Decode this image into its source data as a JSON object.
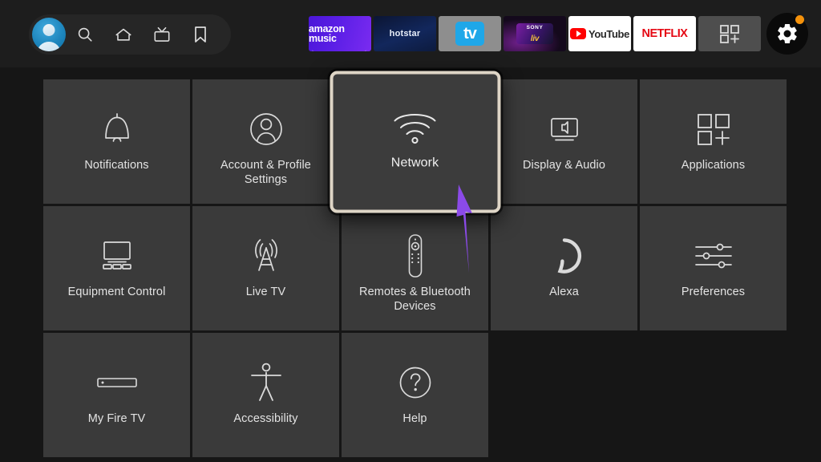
{
  "topbar": {
    "profile": {
      "icon": "profile-avatar-icon",
      "label": "Profile"
    },
    "nav_icons": [
      {
        "name": "search-icon",
        "label": "Search"
      },
      {
        "name": "home-icon",
        "label": "Home"
      },
      {
        "name": "live-tv-icon",
        "label": "Live TV"
      },
      {
        "name": "bookmark-icon",
        "label": "Watchlist"
      }
    ],
    "apps": [
      {
        "id": "amazon-music",
        "label": "amazon music",
        "bg": "#5b1fe6"
      },
      {
        "id": "hotstar",
        "label": "hotstar",
        "bg": "#12275c"
      },
      {
        "id": "apple-tv",
        "label": "tv",
        "bg": "#8e8e8e",
        "accent": "#1fa7e8"
      },
      {
        "id": "sony-liv",
        "label": "SONY",
        "sublabel": "liv",
        "bg": "#0a0a12",
        "accent": "#f5c33b"
      },
      {
        "id": "youtube",
        "label": "YouTube",
        "bg": "#ffffff",
        "accent": "#ff0000"
      },
      {
        "id": "netflix",
        "label": "NETFLIX",
        "bg": "#ffffff",
        "accent": "#e50914"
      },
      {
        "id": "apps-grid",
        "label": "",
        "icon": "apps-grid-plus-icon",
        "bg": "#4e4e4e"
      }
    ],
    "settings": {
      "icon": "gear-icon",
      "badge": true,
      "badge_color": "#f5920b"
    }
  },
  "grid": {
    "rows": [
      [
        {
          "label": "Notifications",
          "icon": "bell-icon",
          "focused": false
        },
        {
          "label": "Account & Profile Settings",
          "icon": "person-circle-icon",
          "focused": false
        },
        {
          "label": "Network",
          "icon": "wifi-icon",
          "focused": true
        },
        {
          "label": "Display & Audio",
          "icon": "display-audio-icon",
          "focused": false
        },
        {
          "label": "Applications",
          "icon": "apps-grid-plus-icon",
          "focused": false
        }
      ],
      [
        {
          "label": "Equipment Control",
          "icon": "equipment-control-icon",
          "focused": false
        },
        {
          "label": "Live TV",
          "icon": "broadcast-tower-icon",
          "focused": false
        },
        {
          "label": "Remotes & Bluetooth Devices",
          "icon": "remote-control-icon",
          "focused": false
        },
        {
          "label": "Alexa",
          "icon": "alexa-ring-icon",
          "focused": false
        },
        {
          "label": "Preferences",
          "icon": "sliders-icon",
          "focused": false
        }
      ],
      [
        {
          "label": "My Fire TV",
          "icon": "fire-tv-stick-icon",
          "focused": false
        },
        {
          "label": "Accessibility",
          "icon": "accessibility-icon",
          "focused": false
        },
        {
          "label": "Help",
          "icon": "question-circle-icon",
          "focused": false
        }
      ]
    ]
  },
  "annotation": {
    "arrow": {
      "color": "#8b4ae8",
      "points_to": "Network"
    }
  },
  "theme": {
    "background": "#161616",
    "tile": "#3a3a3a",
    "topbar": "#1d1d1d",
    "focus_border": "#ded5c6",
    "text": "#e3e3e3"
  }
}
